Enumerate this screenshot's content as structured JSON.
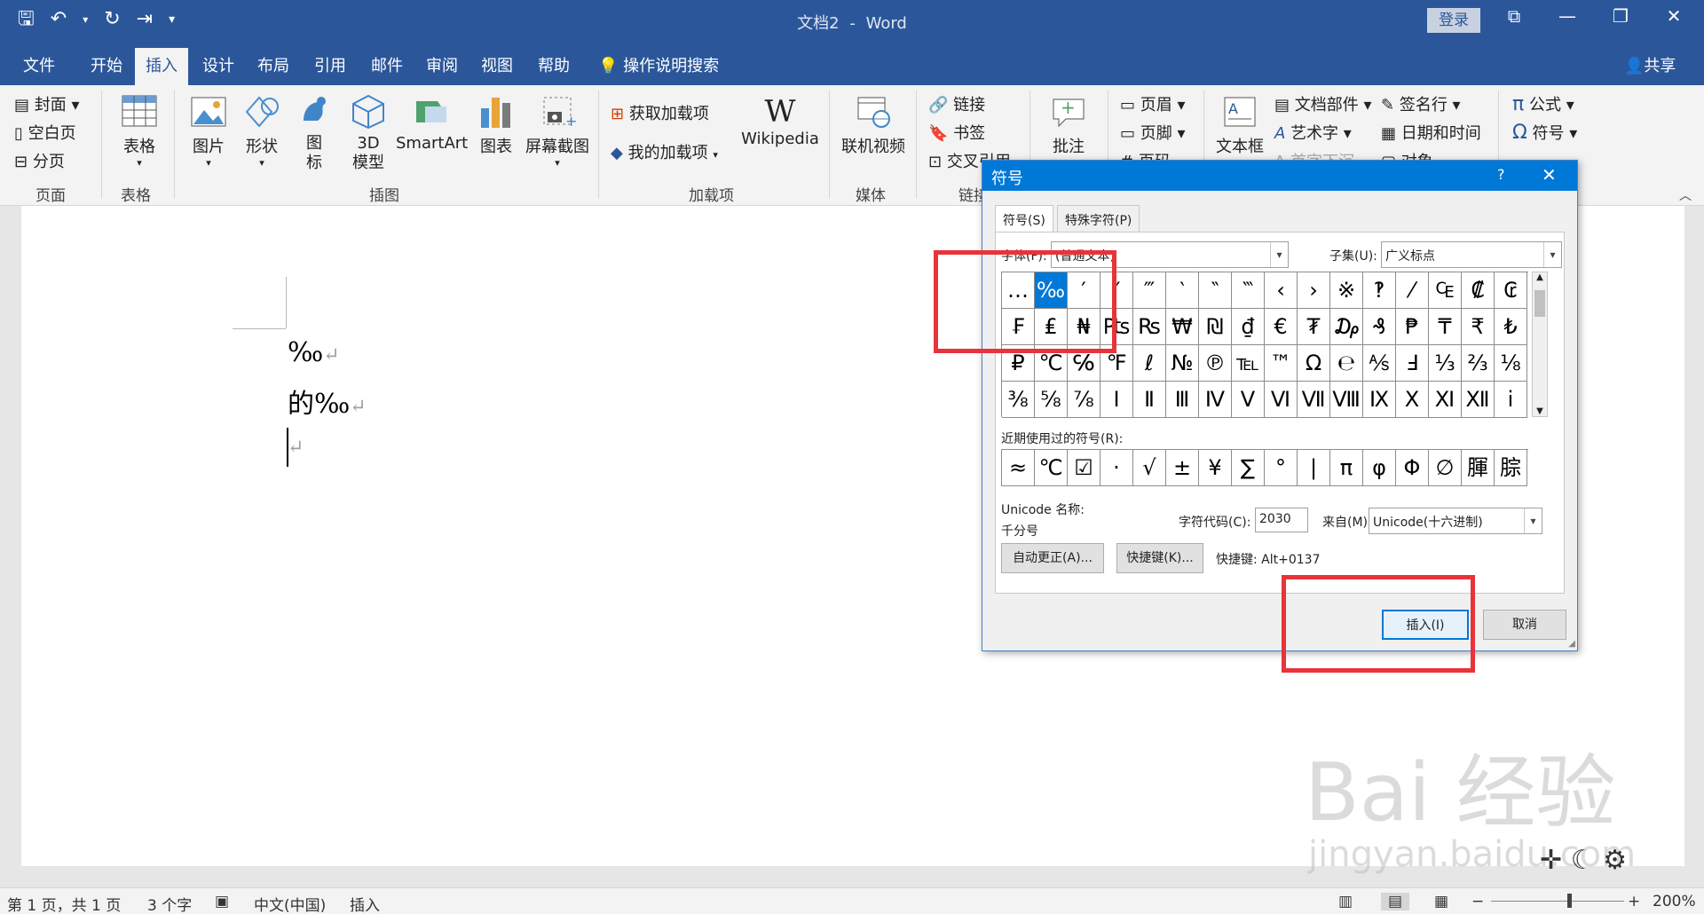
{
  "title": {
    "doc": "文档2",
    "sep": "-",
    "app": "Word",
    "login": "登录"
  },
  "tabs": [
    "文件",
    "开始",
    "插入",
    "设计",
    "布局",
    "引用",
    "邮件",
    "审阅",
    "视图",
    "帮助"
  ],
  "tell_me": "操作说明搜索",
  "share": "共享",
  "ribbon": {
    "pages": {
      "cover": "封面",
      "blank": "空白页",
      "break": "分页",
      "group": "页面"
    },
    "table": {
      "label": "表格",
      "group": "表格"
    },
    "illustrations": {
      "picture": "图片",
      "shapes": "形状",
      "icons": "图\n标",
      "model3d": "3D\n模型",
      "smartart": "SmartArt",
      "chart": "图表",
      "screenshot": "屏幕截图",
      "group": "插图"
    },
    "addins": {
      "get": "获取加载项",
      "mine": "我的加载项",
      "wikipedia": "Wikipedia",
      "group": "加载项"
    },
    "media": {
      "video": "联机视频",
      "group": "媒体"
    },
    "links": {
      "link": "链接",
      "bookmark": "书签",
      "cross": "交叉引用",
      "group": "链接"
    },
    "comments": {
      "comment": "批注"
    },
    "header": {
      "header": "页眉",
      "footer": "页脚",
      "page": "页码"
    },
    "text": {
      "textbox": "文本框",
      "parts": "文档部件",
      "wordart": "艺术字",
      "dropcap": "首字下沉",
      "signature": "签名行",
      "datetime": "日期和时间",
      "object": "对象"
    },
    "symbols": {
      "equation": "公式",
      "symbol": "符号"
    }
  },
  "doc": {
    "line1": "‰",
    "line2": "的‰",
    "para_mark": "↵"
  },
  "dialog": {
    "title": "符号",
    "help": "?",
    "tab_symbols": "符号(S)",
    "tab_special": "特殊字符(P)",
    "font_label": "字体(F):",
    "font_value": "(普通文本)",
    "subset_label": "子集(U):",
    "subset_value": "广义标点",
    "grid": [
      [
        "…",
        "‰",
        "′",
        "″",
        "‴",
        "‵",
        "‶",
        "‷",
        "‹",
        "›",
        "※",
        "‽",
        "⁄",
        "₠",
        "₡",
        "₢"
      ],
      [
        "₣",
        "₤",
        "₦",
        "₧",
        "₨",
        "₩",
        "₪",
        "₫",
        "€",
        "₮",
        "₯",
        "₰",
        "₱",
        "₸",
        "₹",
        "₺"
      ],
      [
        "₽",
        "℃",
        "℅",
        "℉",
        "ℓ",
        "№",
        "℗",
        "℡",
        "™",
        "Ω",
        "℮",
        "⅍",
        "Ⅎ",
        "⅓",
        "⅔",
        "⅛"
      ],
      [
        "⅜",
        "⅝",
        "⅞",
        "Ⅰ",
        "Ⅱ",
        "Ⅲ",
        "Ⅳ",
        "Ⅴ",
        "Ⅵ",
        "Ⅶ",
        "Ⅷ",
        "Ⅸ",
        "Ⅹ",
        "Ⅺ",
        "Ⅻ",
        "ⅰ"
      ]
    ],
    "recent_label": "近期使用过的符号(R):",
    "recent": [
      "≈",
      "℃",
      "☑",
      "·",
      "√",
      "±",
      "¥",
      "∑",
      "°",
      "|",
      "π",
      "φ",
      "Φ",
      "∅",
      "腪",
      "腙"
    ],
    "unicode_name_label": "Unicode 名称:",
    "unicode_name": "千分号",
    "code_label": "字符代码(C):",
    "code_value": "2030",
    "from_label": "来自(M):",
    "from_value": "Unicode(十六进制)",
    "autocorrect": "自动更正(A)...",
    "shortcut_btn": "快捷键(K)...",
    "shortcut_text": "快捷键: Alt+0137",
    "insert": "插入(I)",
    "cancel": "取消"
  },
  "status": {
    "page": "第 1 页，共 1 页",
    "words": "3 个字",
    "lang": "中文(中国)",
    "mode": "插入",
    "zoom": "200%"
  },
  "watermark": {
    "main": "Bai 经验",
    "url": "jingyan.baidu.com"
  }
}
